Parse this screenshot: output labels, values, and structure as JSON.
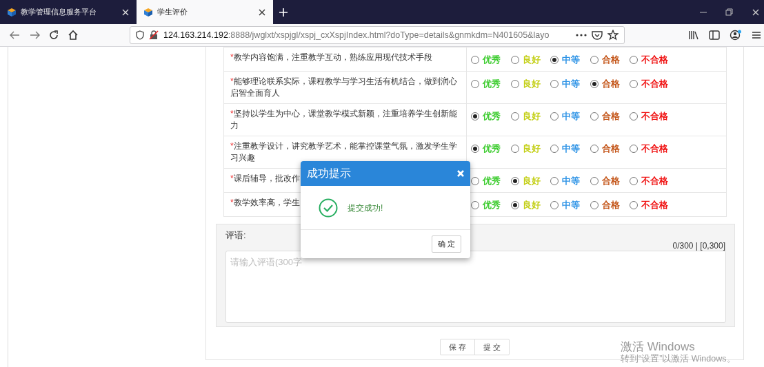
{
  "browser": {
    "tabs": [
      {
        "title": "教学管理信息服务平台",
        "selected": false
      },
      {
        "title": "学生评价",
        "selected": true
      }
    ],
    "url": {
      "host": "124.163.214.192",
      "rest": ":8888/jwglxt/xspjgl/xspj_cxXspjIndex.html?doType=details&gnmkdm=N401605&layo"
    }
  },
  "evaluation": {
    "items": [
      {
        "mark": "*",
        "text": "教学内容饱满，注重教学互动，熟练应用现代技术手段",
        "ratings": [
          {
            "label": "优秀",
            "color": "#3ccc2e",
            "selected": false
          },
          {
            "label": "良好",
            "color": "#c3cf14",
            "selected": false
          },
          {
            "label": "中等",
            "color": "#2d93e6",
            "selected": true
          },
          {
            "label": "合格",
            "color": "#c4561a",
            "selected": false
          },
          {
            "label": "不合格",
            "color": "#f01212",
            "selected": false
          }
        ]
      },
      {
        "mark": "*",
        "text": "能够理论联系实际，课程教学与学习生活有机结合，做到润心启智全面育人",
        "ratings": [
          {
            "label": "优秀",
            "color": "#3ccc2e",
            "selected": false
          },
          {
            "label": "良好",
            "color": "#c3cf14",
            "selected": false
          },
          {
            "label": "中等",
            "color": "#2d93e6",
            "selected": false
          },
          {
            "label": "合格",
            "color": "#c4561a",
            "selected": true
          },
          {
            "label": "不合格",
            "color": "#f01212",
            "selected": false
          }
        ]
      },
      {
        "mark": "*",
        "text": "坚持以学生为中心，课堂教学模式新颖，注重培养学生创新能力",
        "ratings": [
          {
            "label": "优秀",
            "color": "#3ccc2e",
            "selected": true
          },
          {
            "label": "良好",
            "color": "#c3cf14",
            "selected": false
          },
          {
            "label": "中等",
            "color": "#2d93e6",
            "selected": false
          },
          {
            "label": "合格",
            "color": "#c4561a",
            "selected": false
          },
          {
            "label": "不合格",
            "color": "#f01212",
            "selected": false
          }
        ]
      },
      {
        "mark": "*",
        "text": "注重教学设计，讲究教学艺术，能掌控课堂气氛，激发学生学习兴趣",
        "ratings": [
          {
            "label": "优秀",
            "color": "#3ccc2e",
            "selected": true
          },
          {
            "label": "良好",
            "color": "#c3cf14",
            "selected": false
          },
          {
            "label": "中等",
            "color": "#2d93e6",
            "selected": false
          },
          {
            "label": "合格",
            "color": "#c4561a",
            "selected": false
          },
          {
            "label": "不合格",
            "color": "#f01212",
            "selected": false
          }
        ]
      },
      {
        "mark": "*",
        "text": "课后辅导，批改作",
        "ratings": [
          {
            "label": "优秀",
            "color": "#3ccc2e",
            "selected": false
          },
          {
            "label": "良好",
            "color": "#c3cf14",
            "selected": true
          },
          {
            "label": "中等",
            "color": "#2d93e6",
            "selected": false
          },
          {
            "label": "合格",
            "color": "#c4561a",
            "selected": false
          },
          {
            "label": "不合格",
            "color": "#f01212",
            "selected": false
          }
        ]
      },
      {
        "mark": "*",
        "text": "教学效率高，学生",
        "ratings": [
          {
            "label": "优秀",
            "color": "#3ccc2e",
            "selected": false
          },
          {
            "label": "良好",
            "color": "#c3cf14",
            "selected": true
          },
          {
            "label": "中等",
            "color": "#2d93e6",
            "selected": false
          },
          {
            "label": "合格",
            "color": "#c4561a",
            "selected": false
          },
          {
            "label": "不合格",
            "color": "#f01212",
            "selected": false
          }
        ]
      }
    ]
  },
  "comment": {
    "label": "评语:",
    "counter": "0/300 | [0,300]",
    "placeholder": "请输入评语(300字"
  },
  "buttons": [
    "保 存",
    "提 交"
  ],
  "dialog": {
    "title": "成功提示",
    "message": "提交成功!",
    "ok": "确 定"
  },
  "watermark": {
    "title": "激活 Windows",
    "subtitle": "转到“设置”以激活 Windows。"
  }
}
